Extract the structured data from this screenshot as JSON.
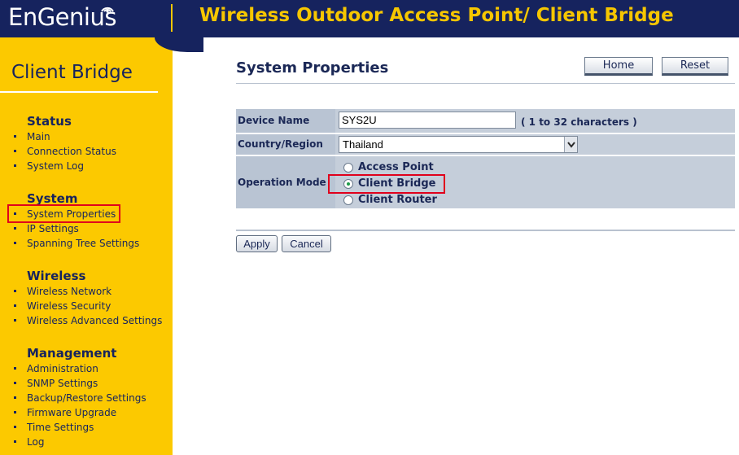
{
  "header": {
    "logo": "EnGenius",
    "title": "Wireless Outdoor Access Point/ Client Bridge"
  },
  "sidebar": {
    "title": "Client Bridge",
    "sections": [
      {
        "name": "Status",
        "items": [
          "Main",
          "Connection Status",
          "System Log"
        ]
      },
      {
        "name": "System",
        "items": [
          "System Properties",
          "IP Settings",
          "Spanning Tree Settings"
        ]
      },
      {
        "name": "Wireless",
        "items": [
          "Wireless Network",
          "Wireless Security",
          "Wireless Advanced Settings"
        ]
      },
      {
        "name": "Management",
        "items": [
          "Administration",
          "SNMP Settings",
          "Backup/Restore Settings",
          "Firmware Upgrade",
          "Time Settings",
          "Log"
        ]
      }
    ],
    "selected": "System Properties"
  },
  "main": {
    "title": "System Properties",
    "home_label": "Home",
    "reset_label": "Reset",
    "device_name": {
      "label": "Device Name",
      "value": "SYS2U",
      "hint": "( 1 to 32 characters )"
    },
    "country": {
      "label": "Country/Region",
      "value": "Thailand"
    },
    "operation_mode": {
      "label": "Operation Mode",
      "options": [
        "Access Point",
        "Client Bridge",
        "Client Router"
      ],
      "selected": "Client Bridge"
    },
    "apply_label": "Apply",
    "cancel_label": "Cancel"
  },
  "colors": {
    "header_bg": "#16235e",
    "accent_yellow": "#fcc900",
    "highlight_red": "#e0001c",
    "radio_selected": "#1e9a4a"
  }
}
